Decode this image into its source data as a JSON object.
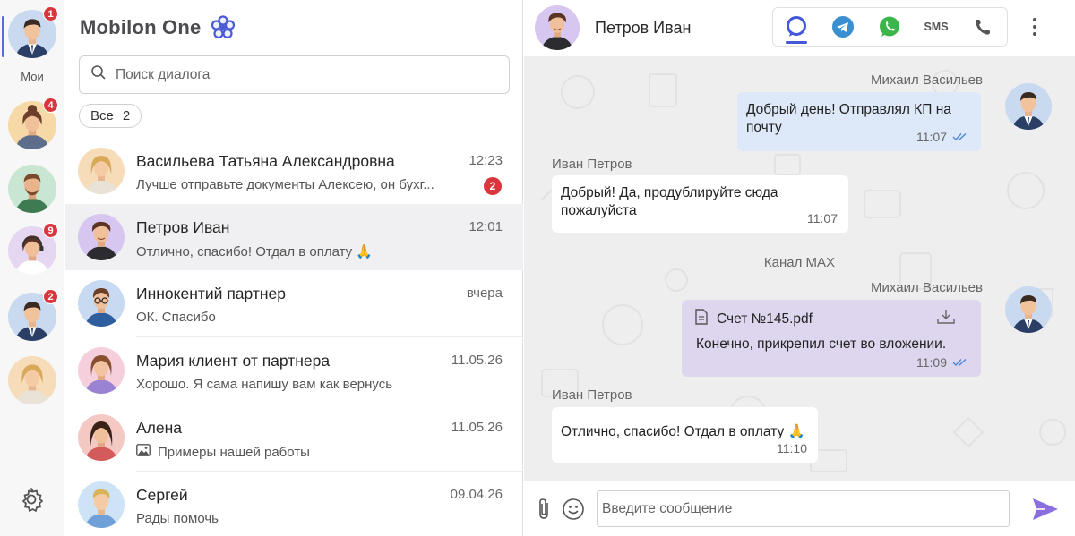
{
  "colors": {
    "accent": "#5b6bd6",
    "badge": "#d9363e",
    "outgoing": "#dde9f8",
    "file_bubble": "#ddd6ee",
    "chat_bg": "#eeeeef"
  },
  "rail": {
    "my_label": "Мои",
    "items": [
      {
        "icon": "businessman-avatar",
        "badge": "1"
      },
      {
        "icon": "woman-avatar",
        "badge": "4"
      },
      {
        "icon": "bearded-man-avatar",
        "badge": ""
      },
      {
        "icon": "woman-headset-avatar",
        "badge": "9"
      },
      {
        "icon": "businessman-avatar",
        "badge": "2"
      },
      {
        "icon": "blonde-woman-avatar",
        "badge": ""
      }
    ],
    "settings_icon": "gear-icon"
  },
  "list": {
    "brand": "Mobilon One",
    "search_placeholder": "Поиск диалога",
    "filter": {
      "label": "Все",
      "count": "2"
    },
    "dialogs": [
      {
        "name": "Васильева Татьяна Александровна",
        "time": "12:23",
        "preview": "Лучше отправьте документы Алексею, он бухг...",
        "badge": "2"
      },
      {
        "name": "Петров Иван",
        "time": "12:01",
        "preview": "Отлично, спасибо! Отдал в оплату 🙏",
        "badge": ""
      },
      {
        "name": "Иннокентий партнер",
        "time": "вчера",
        "preview": "ОК. Спасибо",
        "badge": ""
      },
      {
        "name": "Мария клиент от партнера",
        "time": "11.05.26",
        "preview": "Хорошо. Я сама напишу вам как вернусь",
        "badge": ""
      },
      {
        "name": "Алена",
        "time": "11.05.26",
        "preview": "Примеры нашей работы",
        "badge": ""
      },
      {
        "name": "Сергей",
        "time": "09.04.26",
        "preview": "Рады помочь",
        "badge": ""
      }
    ]
  },
  "chat": {
    "title": "Петров Иван",
    "channels": [
      "max-icon",
      "telegram-icon",
      "whatsapp-icon",
      "SMS",
      "phone-icon"
    ],
    "messages": {
      "m1": {
        "sender": "Михаил Васильев",
        "line1": "Добрый день! Отправлял КП на",
        "line2": "почту",
        "time": "11:07"
      },
      "m2": {
        "sender": "Иван Петров",
        "line1": "Добрый! Да, продублируйте сюда",
        "line2": "пожалуйста",
        "time": "11:07"
      },
      "note": "Канал MAX",
      "m3": {
        "sender": "Михаил Васильев",
        "file": "Счет №145.pdf",
        "text": "Конечно, прикрепил счет во вложении.",
        "time": "11:09"
      },
      "m4": {
        "sender": "Иван Петров",
        "text": "Отлично, спасибо! Отдал в оплату 🙏",
        "time": "11:10"
      }
    },
    "input_placeholder": "Введите сообщение"
  }
}
